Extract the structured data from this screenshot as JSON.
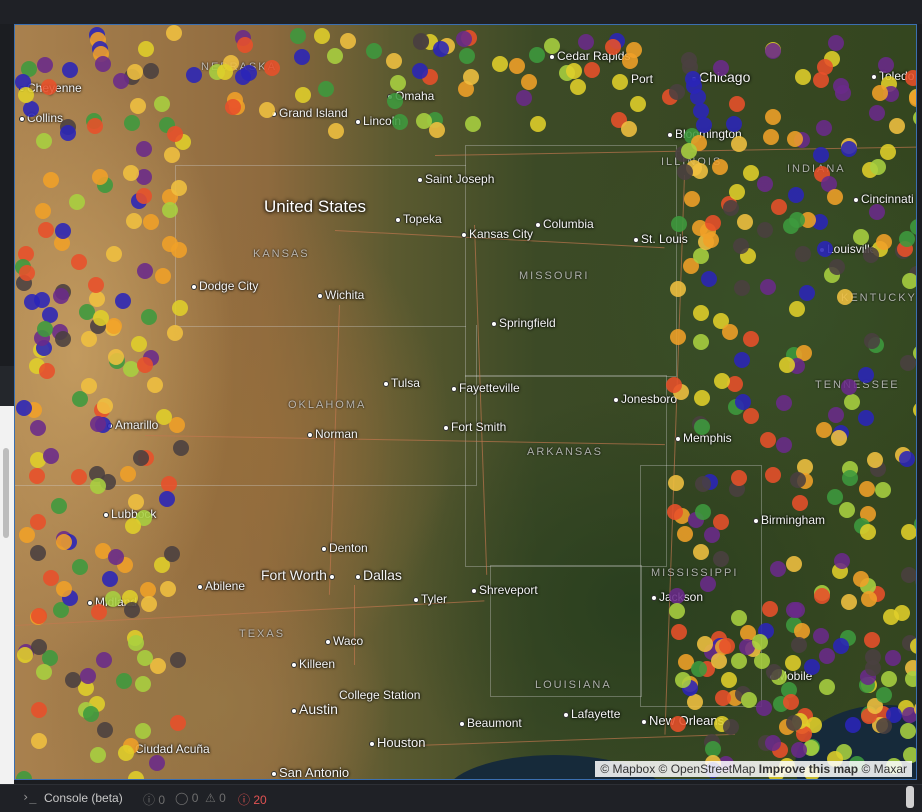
{
  "map": {
    "country_label": "United States",
    "state_labels": [
      "NEBRASKA",
      "KANSAS",
      "MISSOURI",
      "OKLAHOMA",
      "ARKANSAS",
      "TEXAS",
      "LOUISIANA",
      "MISSISSIPPI",
      "ILLINOIS",
      "INDIANA",
      "KENTUCKY",
      "TENNESSEE"
    ],
    "cities": [
      "Cheyenne",
      "Collins",
      "Grand Island",
      "Omaha",
      "Lincoln",
      "Cedar Rapids",
      "Chicago",
      "Toledo",
      "Bloomington",
      "Cincinnati",
      "Saint Joseph",
      "Topeka",
      "Kansas City",
      "Columbia",
      "St. Louis",
      "Louisville",
      "Dodge City",
      "Wichita",
      "Springfield",
      "Tulsa",
      "Fayetteville",
      "Jonesboro",
      "Amarillo",
      "Norman",
      "Fort Smith",
      "Memphis",
      "Lubbock",
      "Birmingham",
      "Denton",
      "Fort Worth",
      "Dallas",
      "Abilene",
      "Tyler",
      "Shreveport",
      "Jackson",
      "Midland",
      "Waco",
      "Killeen",
      "College Station",
      "Austin",
      "Beaumont",
      "Lafayette",
      "New Orleans",
      "Mobile",
      "Houston",
      "Ciudad Acuña",
      "San Antonio",
      "Port"
    ],
    "point_colors": [
      "#e0cf2a",
      "#f0a028",
      "#e8502a",
      "#6a2a8a",
      "#2a24b8",
      "#3e9a3e",
      "#a8d040",
      "#f0c040",
      "#4a4040"
    ],
    "attribution": {
      "mapbox": "© Mapbox",
      "osm": "© OpenStreetMap",
      "improve": "Improve this map",
      "maxar": "© Maxar"
    }
  },
  "console": {
    "label": "Console (beta)",
    "counts": {
      "info": "0",
      "log": "0",
      "warn": "0",
      "error": "20"
    }
  }
}
